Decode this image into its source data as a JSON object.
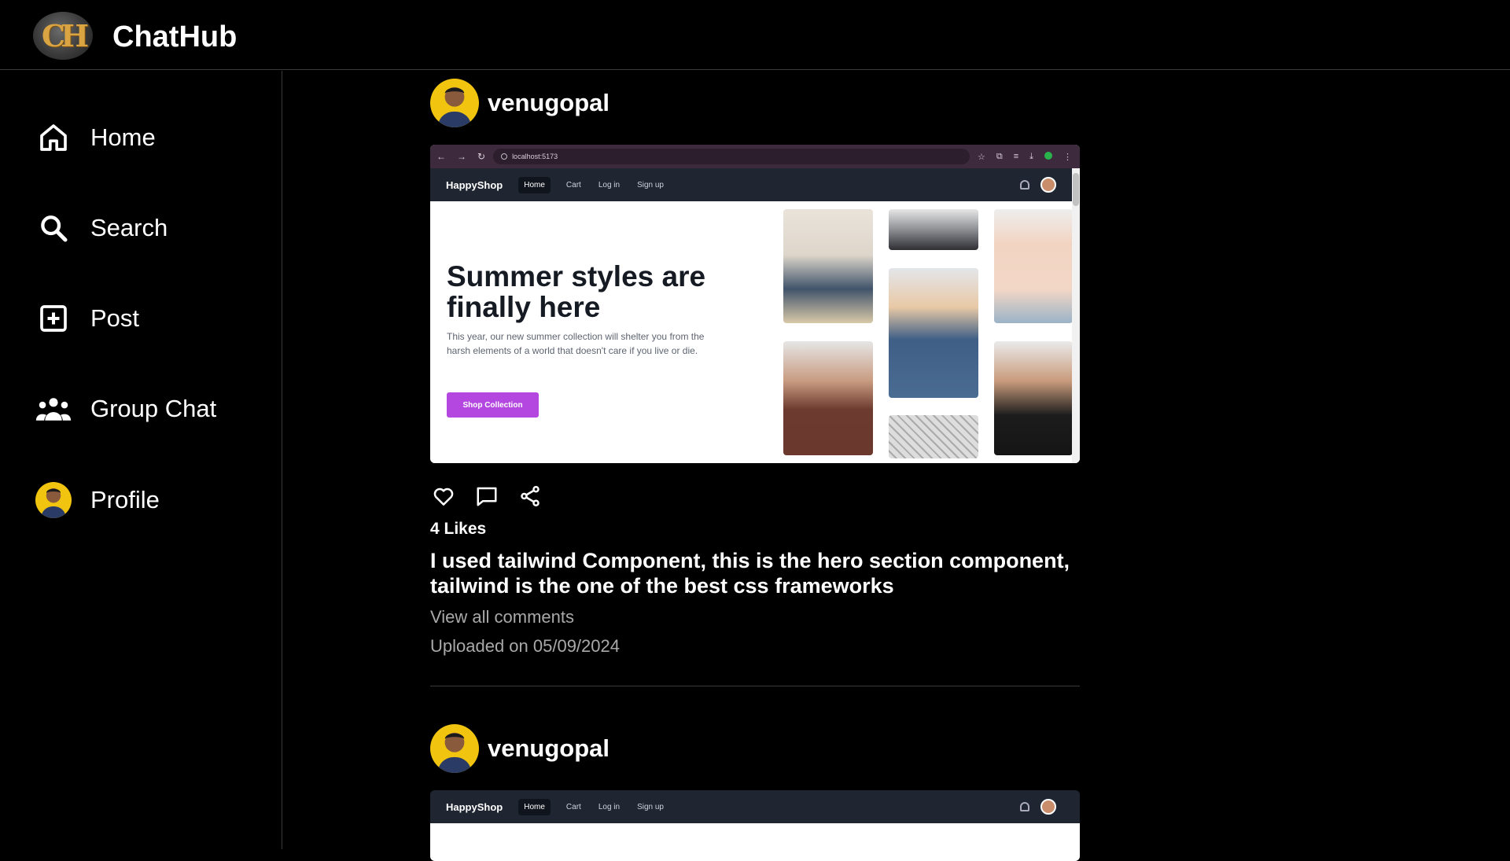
{
  "app": {
    "title": "ChatHub",
    "logo_letters": "CH"
  },
  "sidebar": {
    "items": [
      {
        "label": "Home",
        "icon": "home-icon"
      },
      {
        "label": "Search",
        "icon": "search-icon"
      },
      {
        "label": "Post",
        "icon": "add-box-icon"
      },
      {
        "label": "Group Chat",
        "icon": "group-icon"
      },
      {
        "label": "Profile",
        "icon": "avatar"
      }
    ]
  },
  "posts": [
    {
      "username": "venugopal",
      "likes_text": "4 Likes",
      "caption": "I used tailwind Component, this is the hero section component, tailwind is the one of the best css frameworks",
      "view_comments": "View all comments",
      "uploaded": "Uploaded on 05/09/2024",
      "image": {
        "browser_url": "localhost:5173",
        "site_brand": "HappyShop",
        "site_links": [
          "Home",
          "Cart",
          "Log in",
          "Sign up"
        ],
        "hero_title": "Summer styles are finally here",
        "hero_text": "This year, our new summer collection will shelter you from the harsh elements of a world that doesn't care if you live or die.",
        "hero_button": "Shop Collection"
      }
    },
    {
      "username": "venugopal",
      "image": {
        "site_brand": "HappyShop",
        "site_links": [
          "Home",
          "Cart",
          "Log in",
          "Sign up"
        ]
      }
    }
  ],
  "colors": {
    "accent_button": "#b347e0",
    "site_nav_bg": "#1f2531",
    "browser_bar_bg": "#3d2a3d"
  }
}
